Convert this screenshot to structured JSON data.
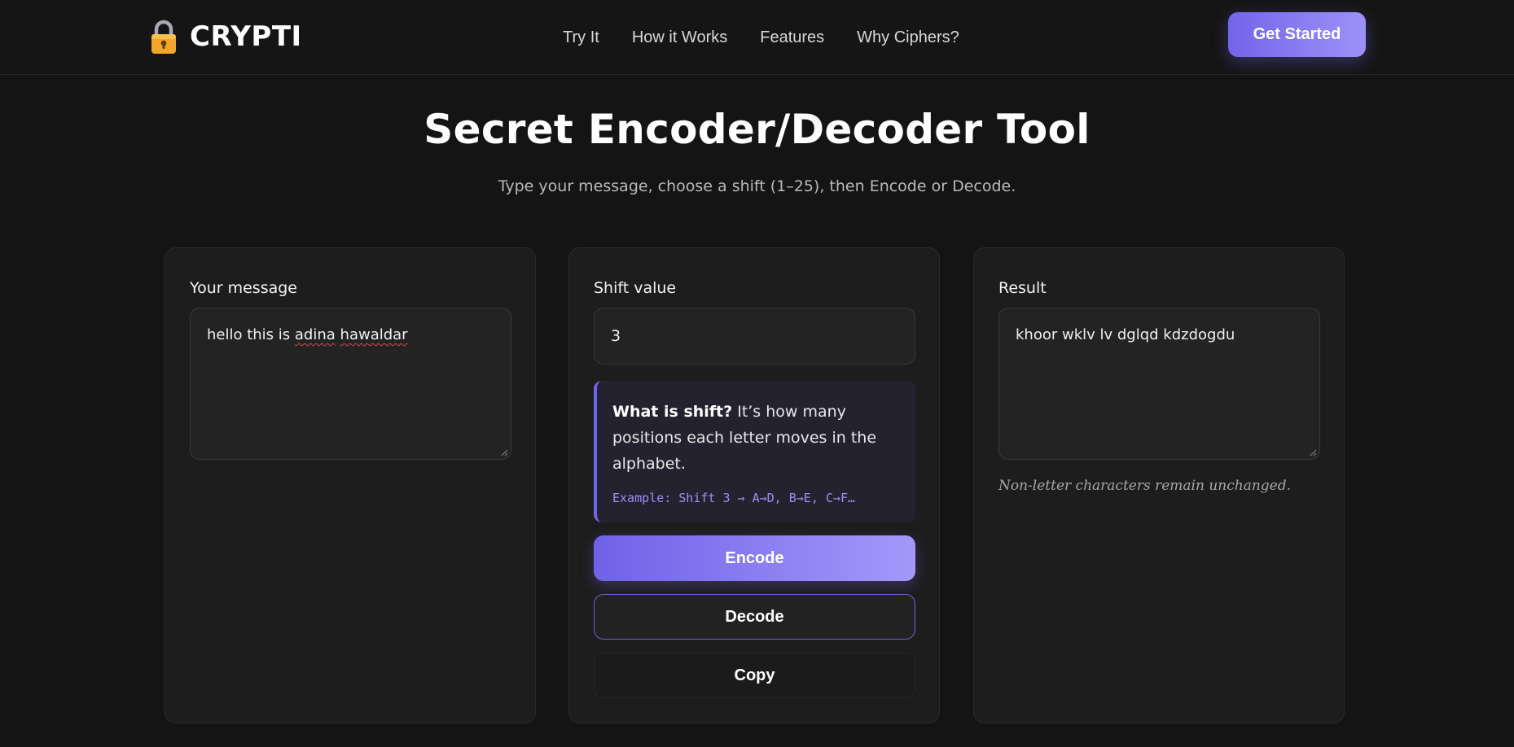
{
  "brand": {
    "name": "CRYPTI"
  },
  "nav": {
    "links": [
      "Try It",
      "How it Works",
      "Features",
      "Why Ciphers?"
    ],
    "cta_label": "Get Started"
  },
  "hero": {
    "title": "Secret Encoder/Decoder Tool",
    "subtitle": "Type your message, choose a shift (1–25), then Encode or Decode."
  },
  "message_card": {
    "label": "Your message",
    "value_plain": "hello this is ",
    "value_misspelled_1": "adina",
    "value_misspelled_2": "hawaldar"
  },
  "shift_card": {
    "label": "Shift value",
    "value": "3",
    "info_title": "What is shift?",
    "info_body": " It’s how many positions each letter moves in the alphabet.",
    "info_example": "Example: Shift 3 → A→D, B→E, C→F…",
    "encode_label": "Encode",
    "decode_label": "Decode",
    "copy_label": "Copy"
  },
  "result_card": {
    "label": "Result",
    "value": "khoor wklv lv dglqd kdzdogdu",
    "note": "Non-letter characters remain unchanged."
  },
  "colors": {
    "background": "#141414",
    "card": "#1d1d1d",
    "accent": "#7264ea",
    "accent_light": "#a299fa"
  }
}
